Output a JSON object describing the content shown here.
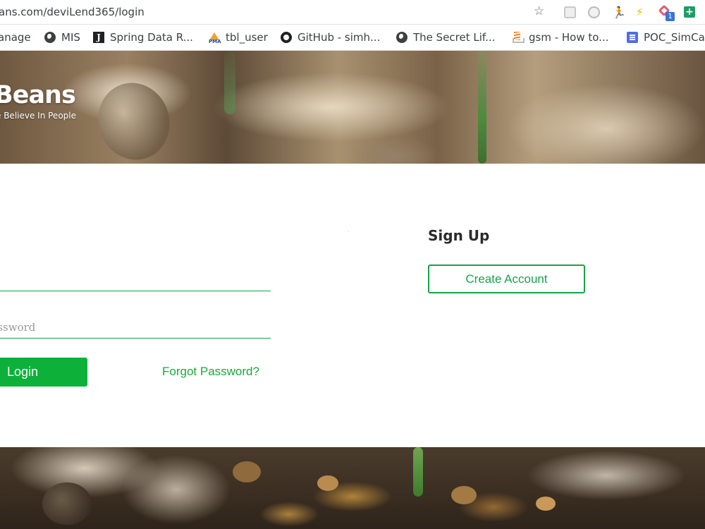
{
  "browser": {
    "url": "ans.com/deviLend365/login",
    "bookmarks": [
      {
        "label": "anage",
        "icon": "none"
      },
      {
        "label": "MIS",
        "icon": "globe-icon"
      },
      {
        "label": "Spring Data R...",
        "icon": "j-icon",
        "glyph": "J"
      },
      {
        "label": "tbl_user",
        "icon": "phpmyadmin-icon",
        "glyph": "PMA"
      },
      {
        "label": "GitHub - simh...",
        "icon": "github-icon"
      },
      {
        "label": "The Secret Lif...",
        "icon": "globe-icon"
      },
      {
        "label": "gsm - How to...",
        "icon": "stackoverflow-icon"
      },
      {
        "label": "POC_SimCar",
        "icon": "google-docs-icon"
      }
    ],
    "extension_badge": "1"
  },
  "hero": {
    "brand": "Beans",
    "tagline": "e Believe In People"
  },
  "login": {
    "email_placeholder": "",
    "password_placeholder": "Password",
    "login_label": "Login",
    "forgot_label": "Forgot Password?"
  },
  "signup": {
    "title": "Sign Up",
    "create_label": "Create Account"
  },
  "colors": {
    "accent_green": "#16a34a",
    "button_green": "#0db13a"
  }
}
